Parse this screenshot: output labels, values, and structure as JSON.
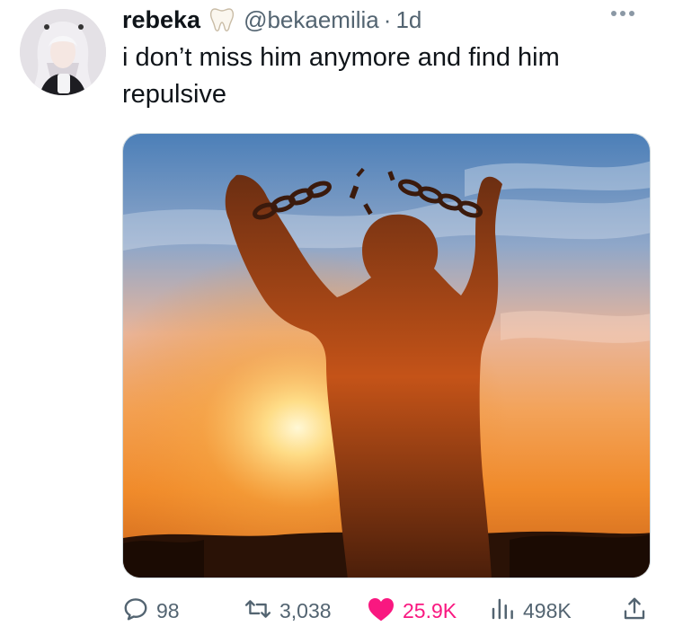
{
  "user": {
    "display_name": "rebeka",
    "handle": "@bekaemilia",
    "separator": "·",
    "time": "1d",
    "badge_icon": "tooth-emoji"
  },
  "tweet": {
    "text": "i don’t miss him anymore and find him repulsive"
  },
  "media": {
    "description_icon": "sunset-breaking-chains-photo"
  },
  "actions": {
    "replies": "98",
    "retweets": "3,038",
    "likes": "25.9K",
    "views": "498K"
  },
  "colors": {
    "text": "#0f1419",
    "secondary": "#536471",
    "like": "#f91880"
  }
}
